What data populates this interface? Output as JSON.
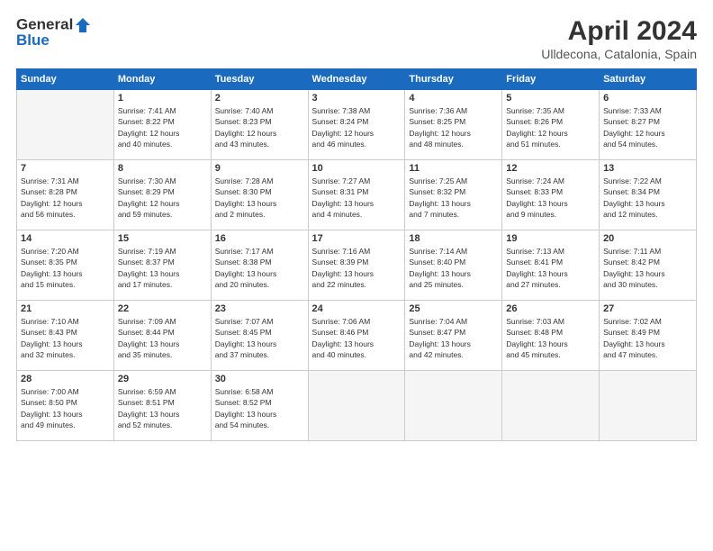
{
  "header": {
    "logo_line1": "General",
    "logo_line2": "Blue",
    "month_year": "April 2024",
    "location": "Ulldecona, Catalonia, Spain"
  },
  "days_of_week": [
    "Sunday",
    "Monday",
    "Tuesday",
    "Wednesday",
    "Thursday",
    "Friday",
    "Saturday"
  ],
  "weeks": [
    [
      {
        "day": "",
        "empty": true
      },
      {
        "day": "1",
        "sunrise": "Sunrise: 7:41 AM",
        "sunset": "Sunset: 8:22 PM",
        "daylight": "Daylight: 12 hours and 40 minutes."
      },
      {
        "day": "2",
        "sunrise": "Sunrise: 7:40 AM",
        "sunset": "Sunset: 8:23 PM",
        "daylight": "Daylight: 12 hours and 43 minutes."
      },
      {
        "day": "3",
        "sunrise": "Sunrise: 7:38 AM",
        "sunset": "Sunset: 8:24 PM",
        "daylight": "Daylight: 12 hours and 46 minutes."
      },
      {
        "day": "4",
        "sunrise": "Sunrise: 7:36 AM",
        "sunset": "Sunset: 8:25 PM",
        "daylight": "Daylight: 12 hours and 48 minutes."
      },
      {
        "day": "5",
        "sunrise": "Sunrise: 7:35 AM",
        "sunset": "Sunset: 8:26 PM",
        "daylight": "Daylight: 12 hours and 51 minutes."
      },
      {
        "day": "6",
        "sunrise": "Sunrise: 7:33 AM",
        "sunset": "Sunset: 8:27 PM",
        "daylight": "Daylight: 12 hours and 54 minutes."
      }
    ],
    [
      {
        "day": "7",
        "sunrise": "Sunrise: 7:31 AM",
        "sunset": "Sunset: 8:28 PM",
        "daylight": "Daylight: 12 hours and 56 minutes."
      },
      {
        "day": "8",
        "sunrise": "Sunrise: 7:30 AM",
        "sunset": "Sunset: 8:29 PM",
        "daylight": "Daylight: 12 hours and 59 minutes."
      },
      {
        "day": "9",
        "sunrise": "Sunrise: 7:28 AM",
        "sunset": "Sunset: 8:30 PM",
        "daylight": "Daylight: 13 hours and 2 minutes."
      },
      {
        "day": "10",
        "sunrise": "Sunrise: 7:27 AM",
        "sunset": "Sunset: 8:31 PM",
        "daylight": "Daylight: 13 hours and 4 minutes."
      },
      {
        "day": "11",
        "sunrise": "Sunrise: 7:25 AM",
        "sunset": "Sunset: 8:32 PM",
        "daylight": "Daylight: 13 hours and 7 minutes."
      },
      {
        "day": "12",
        "sunrise": "Sunrise: 7:24 AM",
        "sunset": "Sunset: 8:33 PM",
        "daylight": "Daylight: 13 hours and 9 minutes."
      },
      {
        "day": "13",
        "sunrise": "Sunrise: 7:22 AM",
        "sunset": "Sunset: 8:34 PM",
        "daylight": "Daylight: 13 hours and 12 minutes."
      }
    ],
    [
      {
        "day": "14",
        "sunrise": "Sunrise: 7:20 AM",
        "sunset": "Sunset: 8:35 PM",
        "daylight": "Daylight: 13 hours and 15 minutes."
      },
      {
        "day": "15",
        "sunrise": "Sunrise: 7:19 AM",
        "sunset": "Sunset: 8:37 PM",
        "daylight": "Daylight: 13 hours and 17 minutes."
      },
      {
        "day": "16",
        "sunrise": "Sunrise: 7:17 AM",
        "sunset": "Sunset: 8:38 PM",
        "daylight": "Daylight: 13 hours and 20 minutes."
      },
      {
        "day": "17",
        "sunrise": "Sunrise: 7:16 AM",
        "sunset": "Sunset: 8:39 PM",
        "daylight": "Daylight: 13 hours and 22 minutes."
      },
      {
        "day": "18",
        "sunrise": "Sunrise: 7:14 AM",
        "sunset": "Sunset: 8:40 PM",
        "daylight": "Daylight: 13 hours and 25 minutes."
      },
      {
        "day": "19",
        "sunrise": "Sunrise: 7:13 AM",
        "sunset": "Sunset: 8:41 PM",
        "daylight": "Daylight: 13 hours and 27 minutes."
      },
      {
        "day": "20",
        "sunrise": "Sunrise: 7:11 AM",
        "sunset": "Sunset: 8:42 PM",
        "daylight": "Daylight: 13 hours and 30 minutes."
      }
    ],
    [
      {
        "day": "21",
        "sunrise": "Sunrise: 7:10 AM",
        "sunset": "Sunset: 8:43 PM",
        "daylight": "Daylight: 13 hours and 32 minutes."
      },
      {
        "day": "22",
        "sunrise": "Sunrise: 7:09 AM",
        "sunset": "Sunset: 8:44 PM",
        "daylight": "Daylight: 13 hours and 35 minutes."
      },
      {
        "day": "23",
        "sunrise": "Sunrise: 7:07 AM",
        "sunset": "Sunset: 8:45 PM",
        "daylight": "Daylight: 13 hours and 37 minutes."
      },
      {
        "day": "24",
        "sunrise": "Sunrise: 7:06 AM",
        "sunset": "Sunset: 8:46 PM",
        "daylight": "Daylight: 13 hours and 40 minutes."
      },
      {
        "day": "25",
        "sunrise": "Sunrise: 7:04 AM",
        "sunset": "Sunset: 8:47 PM",
        "daylight": "Daylight: 13 hours and 42 minutes."
      },
      {
        "day": "26",
        "sunrise": "Sunrise: 7:03 AM",
        "sunset": "Sunset: 8:48 PM",
        "daylight": "Daylight: 13 hours and 45 minutes."
      },
      {
        "day": "27",
        "sunrise": "Sunrise: 7:02 AM",
        "sunset": "Sunset: 8:49 PM",
        "daylight": "Daylight: 13 hours and 47 minutes."
      }
    ],
    [
      {
        "day": "28",
        "sunrise": "Sunrise: 7:00 AM",
        "sunset": "Sunset: 8:50 PM",
        "daylight": "Daylight: 13 hours and 49 minutes."
      },
      {
        "day": "29",
        "sunrise": "Sunrise: 6:59 AM",
        "sunset": "Sunset: 8:51 PM",
        "daylight": "Daylight: 13 hours and 52 minutes."
      },
      {
        "day": "30",
        "sunrise": "Sunrise: 6:58 AM",
        "sunset": "Sunset: 8:52 PM",
        "daylight": "Daylight: 13 hours and 54 minutes."
      },
      {
        "day": "",
        "empty": true
      },
      {
        "day": "",
        "empty": true
      },
      {
        "day": "",
        "empty": true
      },
      {
        "day": "",
        "empty": true
      }
    ]
  ]
}
